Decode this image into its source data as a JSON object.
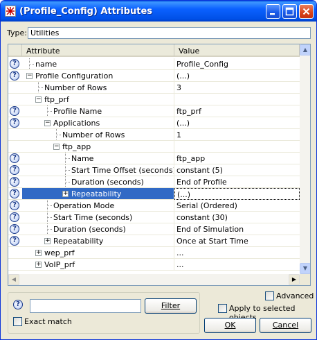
{
  "window": {
    "title": "(Profile_Config) Attributes"
  },
  "type_field": {
    "label": "Type:",
    "value": "Utilities"
  },
  "grid": {
    "columns": [
      "Attribute",
      "Value"
    ],
    "rows": [
      {
        "attr": "name",
        "value": "Profile_Config",
        "help": true
      },
      {
        "attr": "Profile Configuration",
        "value": "(...)",
        "help": true
      },
      {
        "attr": "Number of Rows",
        "value": "3",
        "help": false
      },
      {
        "attr": "ftp_prf",
        "value": "",
        "help": false
      },
      {
        "attr": "Profile Name",
        "value": "ftp_prf",
        "help": true
      },
      {
        "attr": "Applications",
        "value": "(...)",
        "help": true
      },
      {
        "attr": "Number of Rows",
        "value": "1",
        "help": false
      },
      {
        "attr": "ftp_app",
        "value": "",
        "help": false
      },
      {
        "attr": "Name",
        "value": "ftp_app",
        "help": true
      },
      {
        "attr": "Start Time Offset (seconds)",
        "value": "constant (5)",
        "help": true
      },
      {
        "attr": "Duration (seconds)",
        "value": "End of Profile",
        "help": true
      },
      {
        "attr": "Repeatability",
        "value": "(...)",
        "help": true
      },
      {
        "attr": "Operation Mode",
        "value": "Serial (Ordered)",
        "help": true
      },
      {
        "attr": "Start Time (seconds)",
        "value": "constant (30)",
        "help": true
      },
      {
        "attr": "Duration (seconds)",
        "value": "End of Simulation",
        "help": true
      },
      {
        "attr": "Repeatability",
        "value": "Once at Start Time",
        "help": true
      },
      {
        "attr": "wep_prf",
        "value": "...",
        "help": false
      },
      {
        "attr": "VoIP_prf",
        "value": "...",
        "help": false
      }
    ]
  },
  "filter": {
    "button_label": "Filter",
    "input_value": "",
    "exact_match_label": "Exact match"
  },
  "options": {
    "advanced_label": "Advanced",
    "apply_label": "Apply to selected objects"
  },
  "buttons": {
    "ok": "OK",
    "cancel": "Cancel"
  }
}
